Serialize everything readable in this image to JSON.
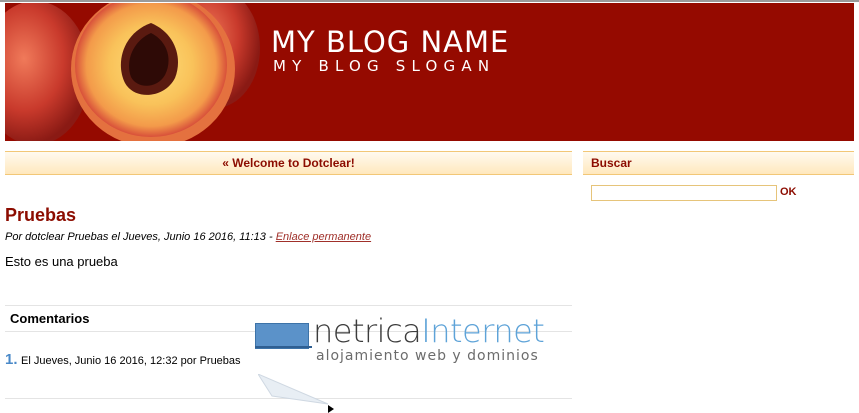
{
  "header": {
    "blog_name": "MY BLOG NAME",
    "blog_slogan": "MY BLOG SLOGAN"
  },
  "nav": {
    "link_label": "« Welcome to Dotclear!"
  },
  "sidebar": {
    "search_title": "Buscar",
    "search_value": "",
    "search_button": "OK"
  },
  "post": {
    "title": "Pruebas",
    "meta": "Por dotclear Pruebas el Jueves, Junio 16 2016, 11:13 - ",
    "permalink": "Enlace permanente",
    "body": "Esto es una prueba"
  },
  "comments": {
    "title": "Comentarios",
    "items": [
      {
        "number": "1.",
        "text": "El Jueves, Junio 16 2016, 12:32 por Pruebas"
      }
    ]
  },
  "watermark": {
    "name_part1": "netrica",
    "name_part2": "Internet",
    "tagline": "alojamiento web y dominios"
  },
  "colors": {
    "header_bg": "#950a00",
    "accent": "#8c0c00",
    "bar_border": "#f2c777",
    "watermark_blue": "#5ea3d8"
  }
}
